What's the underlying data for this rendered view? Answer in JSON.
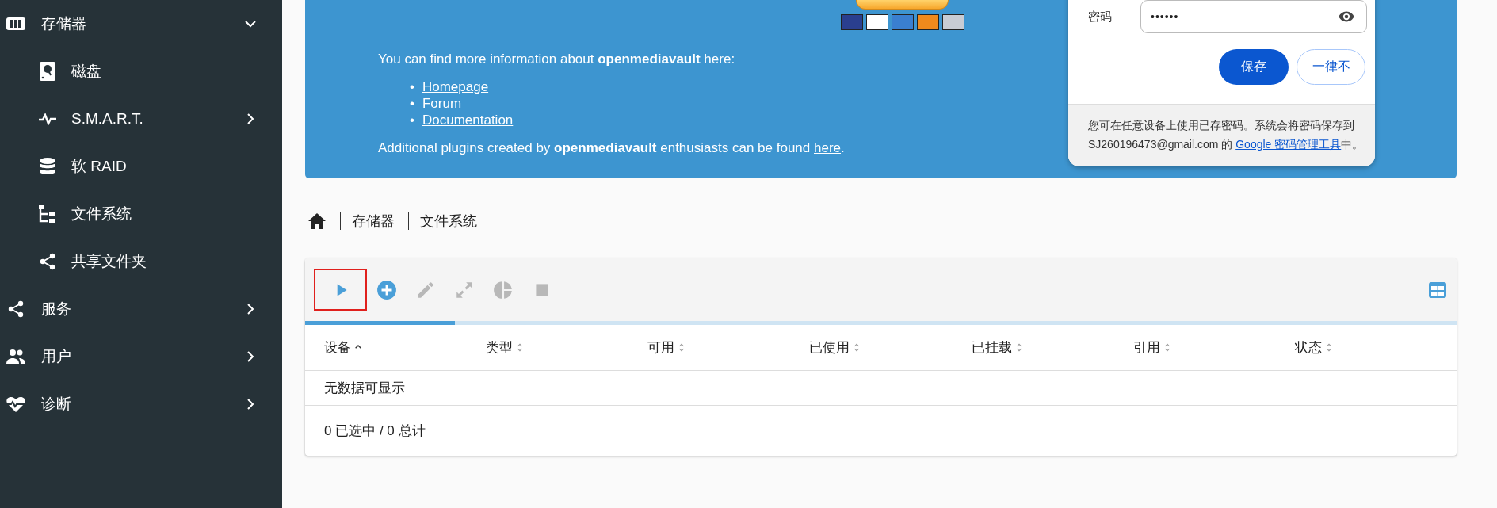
{
  "sidebar": {
    "items": [
      {
        "label": "存储器",
        "expanded": true,
        "children": [
          {
            "label": "磁盘"
          },
          {
            "label": "S.M.A.R.T.",
            "expanded": false
          },
          {
            "label": "软 RAID"
          },
          {
            "label": "文件系统"
          },
          {
            "label": "共享文件夹"
          }
        ]
      },
      {
        "label": "服务",
        "expanded": false
      },
      {
        "label": "用户",
        "expanded": false
      },
      {
        "label": "诊断",
        "expanded": false
      }
    ]
  },
  "banner": {
    "info_text": "You can find more information about **openmediavault** here:",
    "links": [
      {
        "bullet": "•",
        "label": "Homepage"
      },
      {
        "bullet": "•",
        "label": "Forum"
      },
      {
        "bullet": "•",
        "label": "Documentation"
      }
    ],
    "plugins_text": {
      "before": "Additional plugins created by **openmediavault** enthusiasts can be found ",
      "link": "here",
      "after": "."
    }
  },
  "password_popup": {
    "password_label": "密码",
    "password_value": "••••••",
    "save_button": "保存",
    "never_button": "一律不",
    "note": {
      "before": "您可在任意设备上使用已存密码。系统会将密码保存到 SJ260196473@gmail.com 的 ",
      "link": "Google 密码管理工具",
      "after": "中。"
    }
  },
  "breadcrumb": [
    "存储器",
    "文件系统"
  ],
  "toolbar": {
    "buttons": [
      {
        "kind": "play",
        "disabled": false,
        "highlighted": true
      },
      {
        "kind": "add",
        "disabled": false,
        "highlighted": false
      },
      {
        "kind": "edit",
        "disabled": true,
        "highlighted": false
      },
      {
        "kind": "expand",
        "disabled": true,
        "highlighted": false
      },
      {
        "kind": "pie",
        "disabled": true,
        "highlighted": false
      },
      {
        "kind": "stop",
        "disabled": true,
        "highlighted": false
      }
    ],
    "progress": {
      "level": 0.13
    }
  },
  "table": {
    "columns": [
      {
        "label": "设备",
        "sorted": true
      },
      {
        "label": "类型",
        "sorted": false
      },
      {
        "label": "可用",
        "sorted": false
      },
      {
        "label": "已使用",
        "sorted": false
      },
      {
        "label": "已挂载",
        "sorted": false
      },
      {
        "label": "引用",
        "sorted": false
      },
      {
        "label": "状态",
        "sorted": false
      }
    ],
    "empty_text": "无数据可显示",
    "footer": "0 已选中 / 0 总计"
  }
}
